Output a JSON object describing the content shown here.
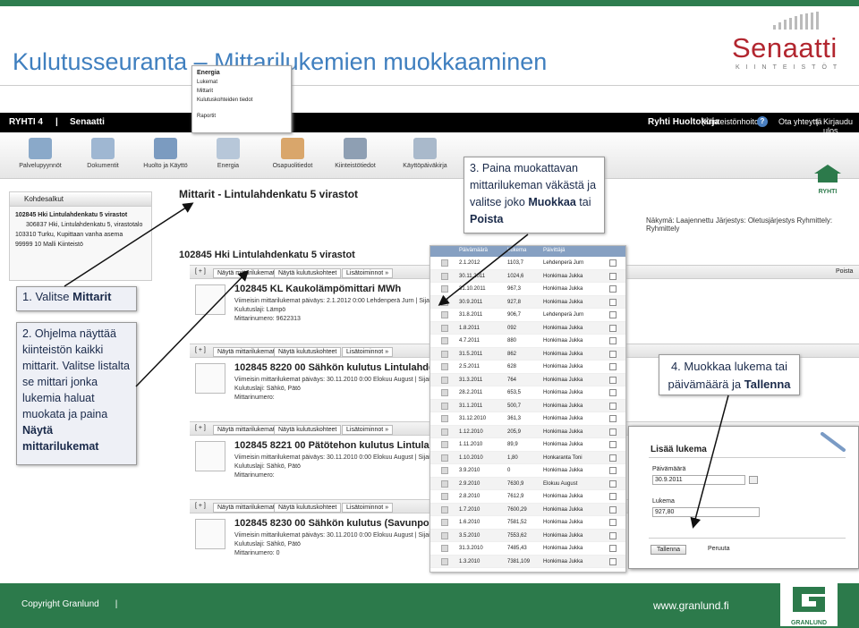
{
  "slide": {
    "title": "Kulutusseuranta – Mittarilukemien muokkaaminen",
    "logo_word": "Senaatti",
    "logo_sub": "KIINTEISTÖT"
  },
  "app": {
    "header": {
      "group": "RYHTI 4",
      "separator": "|",
      "org": "Senaatti",
      "user": "Ryhti Huoltokirja",
      "role": "(Kiinteistönhoito1)",
      "help": "?",
      "contact": "Ota yhteyttä",
      "sep2": "|",
      "logout": "Kirjaudu ulos"
    },
    "toolbar": [
      {
        "label": "Palvelupyynnöt",
        "icon": "phone-icon"
      },
      {
        "label": "Dokumentit",
        "icon": "folder-icon"
      },
      {
        "label": "Huolto ja Käyttö",
        "icon": "tools-icon"
      },
      {
        "label": "Energia",
        "icon": "energy-icon"
      },
      {
        "label": "Osapuolitiedot",
        "icon": "person-icon"
      },
      {
        "label": "Kiinteistötiedot",
        "icon": "building-icon"
      },
      {
        "label": "Käyttöpäiväkirja",
        "icon": "book-icon"
      }
    ],
    "ryhti_label": "RYHTI",
    "left_panel": {
      "title": "Kohdesalkut",
      "tree": [
        "102845 Hki Lintulahdenkatu 5 virastot",
        "306837 Hki, Lintulahdenkatu 5, virastotalo",
        "103310 Turku, Kupittaan vanha asema",
        "99999 10 Malli Kiinteistö"
      ]
    },
    "energy_menu": {
      "title": "Energia",
      "items": [
        "Lukemat",
        "Mittarit",
        "Kulutuskohteiden tiedot",
        "Raportit"
      ]
    },
    "breadcrumb": "Mittarit - Lintulahdenkatu 5 virastot",
    "properties_line": "Näkymä: Laajennettu   Järjestys: Oletusjärjestys   Ryhmittely: Ryhmittely",
    "main_heading": "102845 Hki Lintulahdenkatu 5 virastot",
    "card_buttons": {
      "add": "[ + ]",
      "show_readings": "Näytä mittarilukemat",
      "show_targets": "Näytä kulutuskohteet",
      "more": "Lisätoiminnot »",
      "print": "Poista"
    },
    "meters": [
      {
        "title": "102845 KL Kaukolämpömittari MWh",
        "last": "Viimeisin mittarilukemat päiväys: 2.1.2012 0:00 Lehdenperä Jurn | Sijainti: 1",
        "type": "Kulutuslaji: Lämpö",
        "number": "Mittarinumero: 9622313"
      },
      {
        "title": "102845 8220 00 Sähkön kulutus Lintulahdenkatu",
        "last": "Viimeisin mittarilukemat päiväys: 30.11.2010 0:00 Elokuu August | Sijainti: 1",
        "type": "Kulutuslaji: Sähkö, Pätö",
        "number": "Mittarinumero:"
      },
      {
        "title": "102845 8221 00 Pätötehon kulutus Lintulahdenkatu",
        "last": "Viimeisin mittarilukemat päiväys: 30.11.2010 0:00 Elokuu August | Sijainti: 1",
        "type": "Kulutuslaji: Sähkö, Pätö",
        "number": "Mittarinumero:"
      },
      {
        "title": "102845 8230 00 Sähkön kulutus (Savunpoisto)",
        "last": "Viimeisin mittarilukemat päiväys: 30.11.2010 0:00 Elokuu August | Sijainti: 1",
        "type": "Kulutuslaji: Sähkö, Pätö",
        "number": "Mittarinumero: 0"
      }
    ],
    "readings": {
      "headers": [
        "Päivämäärä",
        "Lukema",
        "Päivittäjä"
      ],
      "rows": [
        [
          "2.1.2012",
          "1103,7",
          "Lehdenperä Jurn"
        ],
        [
          "30.11.2011",
          "1024,6",
          "Honkimaa Jukka"
        ],
        [
          "31.10.2011",
          "967,3",
          "Honkimaa Jukka"
        ],
        [
          "30.9.2011",
          "927,8",
          "Honkimaa Jukka"
        ],
        [
          "31.8.2011",
          "906,7",
          "Lehdenperä Jurn"
        ],
        [
          "1.8.2011",
          "092",
          "Honkimaa Jukka"
        ],
        [
          "4.7.2011",
          "880",
          "Honkimaa Jukka"
        ],
        [
          "31.5.2011",
          "862",
          "Honkimaa Jukka"
        ],
        [
          "2.5.2011",
          "628",
          "Honkimaa Jukka"
        ],
        [
          "31.3.2011",
          "764",
          "Honkimaa Jukka"
        ],
        [
          "28.2.2011",
          "653,5",
          "Honkimaa Jukka"
        ],
        [
          "31.1.2011",
          "500,7",
          "Honkimaa Jukka"
        ],
        [
          "31.12.2010",
          "361,3",
          "Honkimaa Jukka"
        ],
        [
          "1.12.2010",
          "205,9",
          "Honkimaa Jukka"
        ],
        [
          "1.11.2010",
          "89,9",
          "Honkimaa Jukka"
        ],
        [
          "1.10.2010",
          "1,80",
          "Honkaranta Toni"
        ],
        [
          "3.9.2010",
          "0",
          "Honkimaa Jukka"
        ],
        [
          "2.9.2010",
          "7630,9",
          "Elokuu August"
        ],
        [
          "2.8.2010",
          "7612,9",
          "Honkimaa Jukka"
        ],
        [
          "1.7.2010",
          "7600,29",
          "Honkimaa Jukka"
        ],
        [
          "1.6.2010",
          "7581,52",
          "Honkimaa Jukka"
        ],
        [
          "3.5.2010",
          "7553,62",
          "Honkimaa Jukka"
        ],
        [
          "31.3.2010",
          "7485,43",
          "Honkimaa Jukka"
        ],
        [
          "1.3.2010",
          "7381,109",
          "Honkimaa Jukka"
        ]
      ]
    },
    "add_form": {
      "title": "Lisää lukema",
      "date_label": "Päivämäärä",
      "date_value": "30.9.2011",
      "reading_label": "Lukema",
      "reading_value": "927,80",
      "save": "Tallenna",
      "cancel": "Peruuta"
    }
  },
  "callouts": {
    "c1_prefix": "1. Valitse ",
    "c1_bold": "Mittarit",
    "c2_text": "2. Ohjelma näyttää kiinteistön kaikki mittarit. Valitse listalta se mittari jonka lukemia haluat muokata ja paina ",
    "c2_bold": "Näytä mittarilukemat",
    "c3_text": "3. Paina muokattavan mittarilukeman väkästä ja valitse joko ",
    "c3_bold1": "Muokkaa",
    "c3_mid": " tai ",
    "c3_bold2": "Poista",
    "c4_text": "4. Muokkaa lukema tai päivämäärä ja ",
    "c4_bold": "Tallenna"
  },
  "footer": {
    "copyright": "Copyright Granlund",
    "sep": "|",
    "web": "www.granlund.fi",
    "logo_text": "GRANLUND"
  },
  "colors": {
    "brand_green": "#2c7a4b",
    "title_blue": "#3f7fbf",
    "senaatti_red": "#b2262f"
  }
}
